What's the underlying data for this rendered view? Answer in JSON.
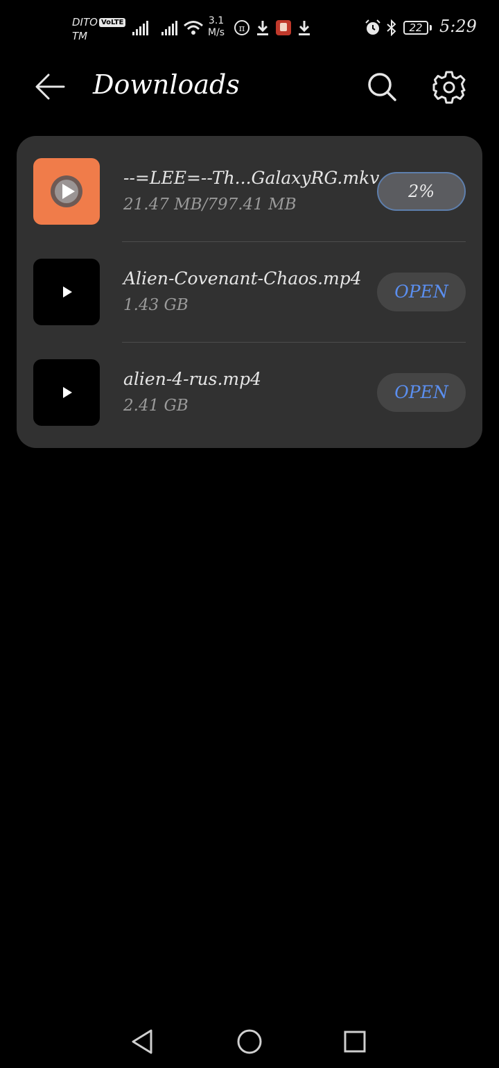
{
  "status_bar": {
    "carrier_line1": "DITO",
    "volte": "VoLTE",
    "carrier_line2": "TM",
    "speed_value": "3.1",
    "speed_unit": "M/s",
    "battery_level": "22",
    "time": "5:29",
    "icons": [
      "signal-icon",
      "signal-icon",
      "wifi-icon",
      "pi-network-icon",
      "download-icon",
      "app-notification-icon",
      "download-icon",
      "alarm-icon",
      "bluetooth-icon",
      "battery-icon"
    ]
  },
  "app_bar": {
    "title": "Downloads",
    "back_icon": "arrow-left-icon",
    "search_icon": "search-icon",
    "settings_icon": "gear-icon"
  },
  "downloads": [
    {
      "name": "--=LEE=--Th...GalaxyRG.mkv",
      "size": "21.47 MB/797.41 MB",
      "action": "2%",
      "progress_percent": 2,
      "thumb_color": "#f07c4a"
    },
    {
      "name": "Alien-Covenant-Chaos.mp4",
      "size": "1.43 GB",
      "action": "OPEN",
      "thumb_color": "#000000"
    },
    {
      "name": "alien-4-rus.mp4",
      "size": "2.41 GB",
      "action": "OPEN",
      "thumb_color": "#000000"
    }
  ],
  "colors": {
    "background": "#000000",
    "card": "#313131",
    "accent_blue": "#5b8ff0",
    "thumb_orange": "#f07c4a"
  },
  "nav_bar": {
    "icons": [
      "back-triangle-icon",
      "home-circle-icon",
      "recents-square-icon"
    ]
  }
}
